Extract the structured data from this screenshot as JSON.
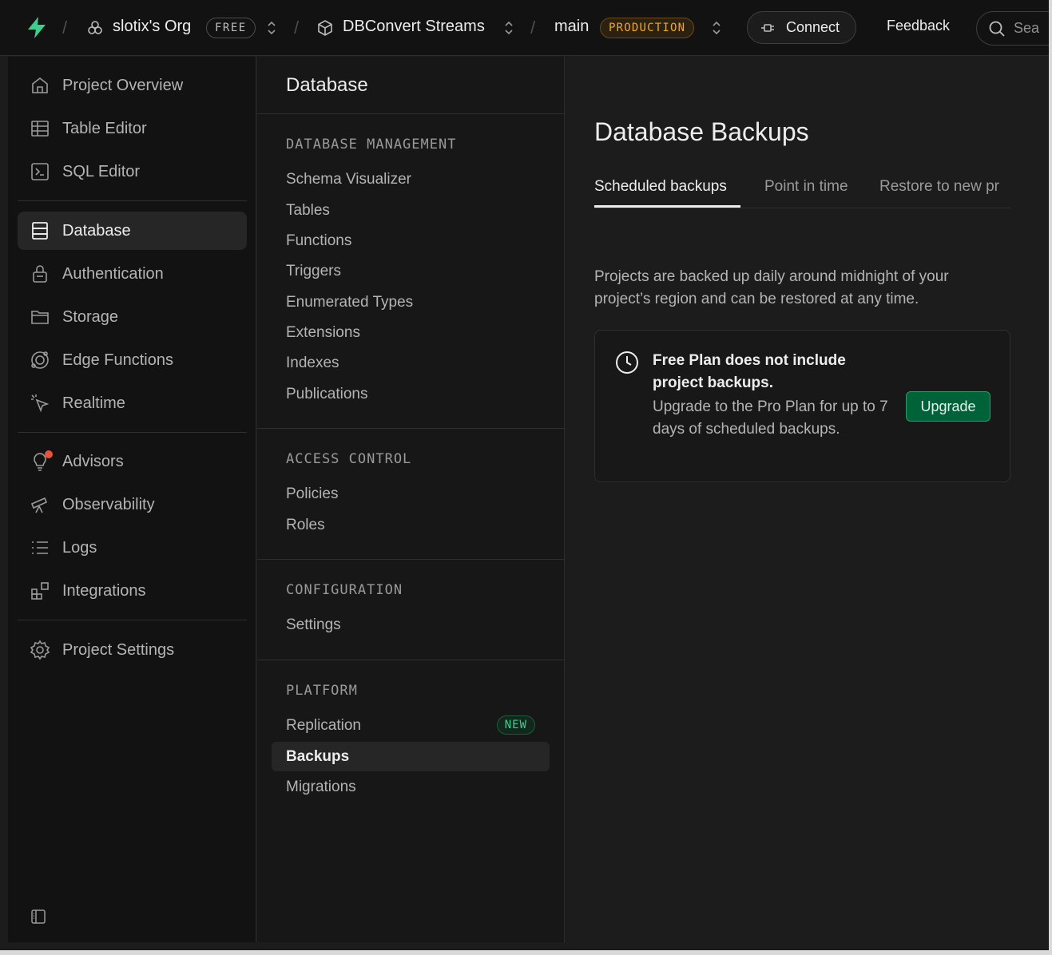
{
  "header": {
    "org_name": "slotix's Org",
    "org_badge": "FREE",
    "project_name": "DBConvert Streams",
    "branch_name": "main",
    "branch_badge": "PRODUCTION",
    "connect_label": "Connect",
    "feedback_label": "Feedback",
    "search_placeholder": "Sea"
  },
  "sidebar": {
    "items": [
      {
        "label": "Project Overview",
        "icon": "home-icon"
      },
      {
        "label": "Table Editor",
        "icon": "table-icon"
      },
      {
        "label": "SQL Editor",
        "icon": "terminal-icon"
      },
      {
        "label": "Database",
        "icon": "database-icon",
        "active": true
      },
      {
        "label": "Authentication",
        "icon": "lock-icon"
      },
      {
        "label": "Storage",
        "icon": "folder-icon"
      },
      {
        "label": "Edge Functions",
        "icon": "edge-functions-icon"
      },
      {
        "label": "Realtime",
        "icon": "cursor-icon"
      },
      {
        "label": "Advisors",
        "icon": "lightbulb-icon"
      },
      {
        "label": "Observability",
        "icon": "telescope-icon"
      },
      {
        "label": "Logs",
        "icon": "list-icon"
      },
      {
        "label": "Integrations",
        "icon": "blocks-icon"
      },
      {
        "label": "Project Settings",
        "icon": "gear-icon"
      }
    ]
  },
  "database_menu": {
    "title": "Database",
    "sections": [
      {
        "heading": "DATABASE MANAGEMENT",
        "items": [
          "Schema Visualizer",
          "Tables",
          "Functions",
          "Triggers",
          "Enumerated Types",
          "Extensions",
          "Indexes",
          "Publications"
        ]
      },
      {
        "heading": "ACCESS CONTROL",
        "items": [
          "Policies",
          "Roles"
        ]
      },
      {
        "heading": "CONFIGURATION",
        "items": [
          "Settings"
        ]
      },
      {
        "heading": "PLATFORM",
        "items": [
          "Replication",
          "Backups",
          "Migrations"
        ]
      }
    ],
    "new_badge": "NEW",
    "active_item": "Backups"
  },
  "main": {
    "title": "Database Backups",
    "tabs": [
      "Scheduled backups",
      "Point in time",
      "Restore to new pr"
    ],
    "active_tab": "Scheduled backups",
    "description": "Projects are backed up daily around midnight of your project’s region and can be restored at any time.",
    "notice": {
      "title": "Free Plan does not include project backups.",
      "body": "Upgrade to the Pro Plan for up to 7 days of scheduled backups.",
      "button": "Upgrade"
    }
  },
  "colors": {
    "brand_green": "#3ecf8e",
    "upgrade_button": "#006239",
    "production_badge": "#f5a623",
    "advisor_dot": "#e5533d"
  }
}
